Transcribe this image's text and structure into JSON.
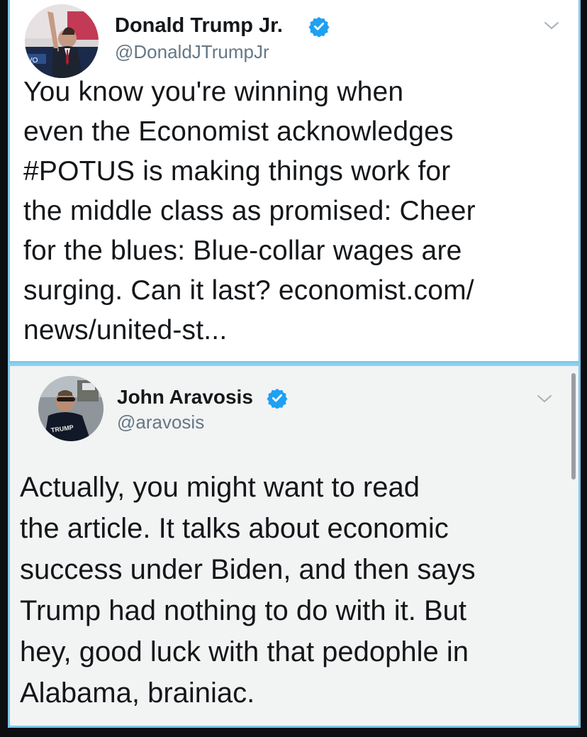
{
  "tweet1": {
    "display_name": "Donald Trump Jr.",
    "handle": "@DonaldJTrumpJr",
    "text": "You know you're winning when\neven the Economist acknowledges\n#POTUS is making things work for\nthe middle class as promised: Cheer\nfor the blues: Blue-collar wages are\nsurging. Can it last? economist.com/\nnews/united-st...",
    "avatar_icon": "profile-photo",
    "verified_icon": "verified-badge-icon",
    "menu_icon": "chevron-down-icon"
  },
  "tweet2": {
    "display_name": "John Aravosis",
    "handle": "@aravosis",
    "text": "Actually, you might want to read\nthe article. It talks about economic\nsuccess under Biden, and then says\nTrump had nothing to do with it. But\nhey, good luck with that pedophle in\nAlabama, brainiac.",
    "avatar_icon": "profile-photo",
    "avatar_shirt_text": "TRUMP",
    "verified_icon": "verified-badge-icon",
    "menu_icon": "chevron-down-icon"
  },
  "colors": {
    "verified_blue": "#1da1f2",
    "border_blue": "#7cc8ec",
    "text": "#14171a",
    "handle_gray": "#657786"
  }
}
